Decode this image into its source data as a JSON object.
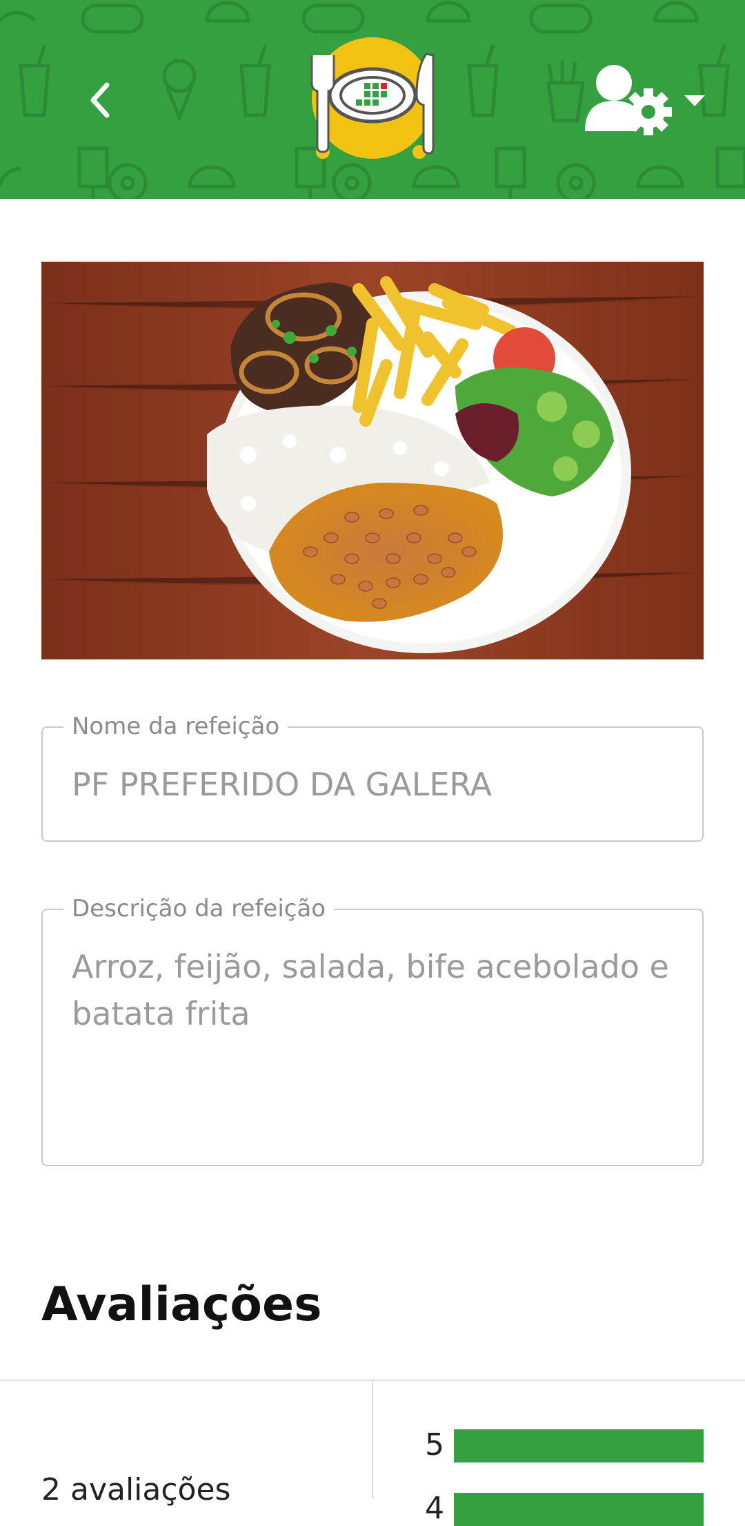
{
  "header": {
    "back_icon": "chevron-left-icon",
    "logo_icon": "plate-cutlery-logo",
    "user_menu_icon": "user-settings-icon",
    "dropdown_icon": "caret-down-icon",
    "colors": {
      "primary": "#34a03f",
      "logo_yellow": "#f2c312"
    }
  },
  "meal": {
    "image_alt": "Prato feito com arroz, feijão, salada, bife acebolado e batata frita",
    "name_label": "Nome da refeição",
    "name_value": "PF PREFERIDO DA GALERA",
    "description_label": "Descrição da refeição",
    "description_value": "Arroz, feijão, salada, bife acebolado e batata frita"
  },
  "ratings": {
    "title": "Avaliações",
    "count_text": "2 avaliações",
    "distribution": [
      {
        "stars": "5",
        "fraction": 1.0
      },
      {
        "stars": "4",
        "fraction": 1.0
      }
    ]
  }
}
